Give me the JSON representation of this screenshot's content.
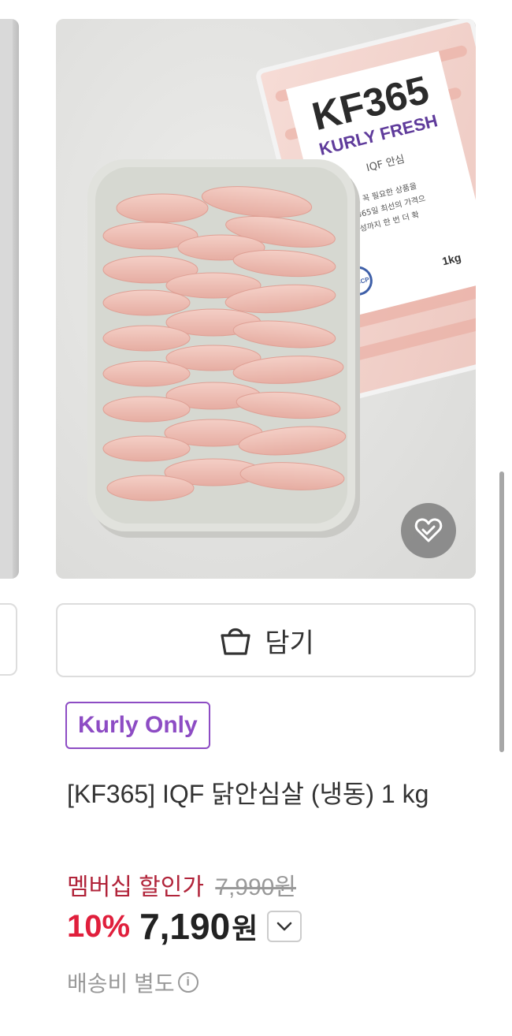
{
  "product": {
    "package": {
      "brand_line1": "KF365",
      "brand_line2": "KURLY FRESH",
      "type": "IQF 안심",
      "bullets": [
        "일상에 꼭 필요한 상품을",
        "1년 365일 최선의 가격으",
        "안전성까지 한 번 더 확"
      ],
      "weight": "1kg",
      "cert": "HACCP"
    },
    "cart_label": "담기",
    "badge": "Kurly Only",
    "title": "[KF365] IQF 닭안심살 (냉동) 1 kg",
    "member_label": "멤버십 할인가",
    "original_price": "7,990원",
    "discount": "10%",
    "price": "7,190",
    "currency": "원",
    "shipping": "배송비 별도"
  },
  "icons": {
    "wish": "heart-check-icon",
    "cart": "shopping-bag-icon",
    "toggle": "chevron-down-icon",
    "info": "info-icon"
  },
  "colors": {
    "badge": "#8d4cc4",
    "member": "#b1243a",
    "discount": "#e01f3c"
  }
}
